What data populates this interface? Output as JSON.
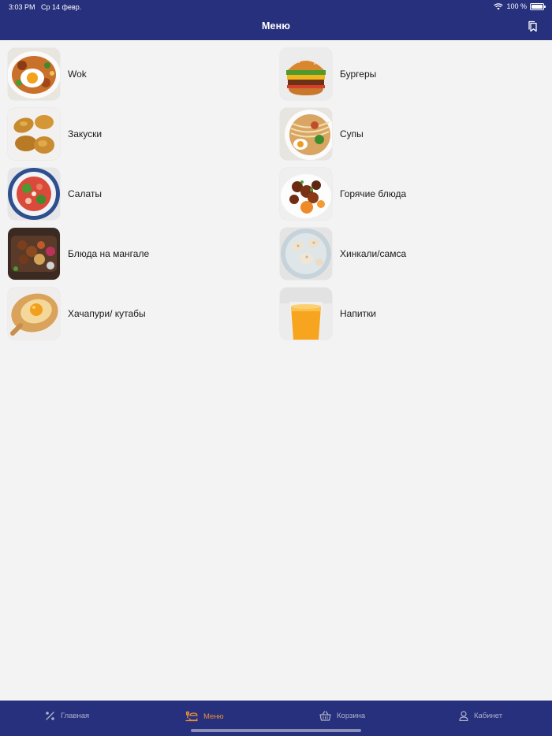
{
  "status_bar": {
    "time": "3:03 PM",
    "date": "Ср 14 февр.",
    "battery": "100 %"
  },
  "header": {
    "title": "Меню",
    "background": "#27307c"
  },
  "categories": [
    {
      "label": "Wok"
    },
    {
      "label": "Бургеры"
    },
    {
      "label": "Закуски"
    },
    {
      "label": "Супы"
    },
    {
      "label": "Салаты"
    },
    {
      "label": "Горячие блюда"
    },
    {
      "label": "Блюда на мангале"
    },
    {
      "label": "Хинкали/самса"
    },
    {
      "label": "Хачапури/ кутабы"
    },
    {
      "label": "Напитки"
    }
  ],
  "tabbar": {
    "active_color": "#e9913a",
    "inactive_color": "#aeb1cc",
    "tabs": [
      {
        "label": "Главная",
        "icon": "percent-icon"
      },
      {
        "label": "Меню",
        "icon": "menu-dish-icon",
        "active": true
      },
      {
        "label": "Корзина",
        "icon": "basket-icon"
      },
      {
        "label": "Кабинет",
        "icon": "user-icon"
      }
    ]
  }
}
